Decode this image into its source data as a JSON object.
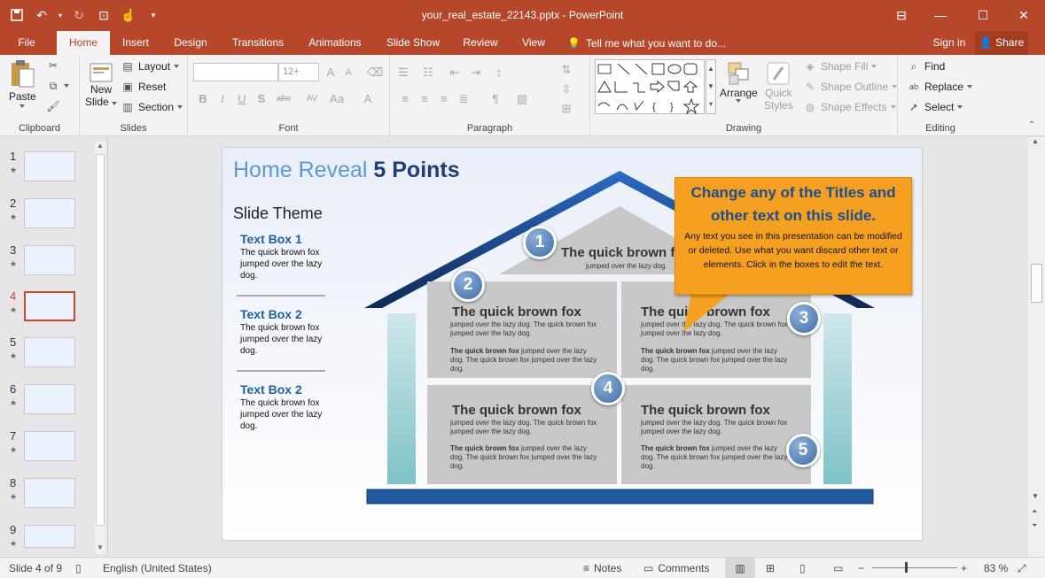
{
  "app": {
    "document_title": "your_real_estate_22143.pptx - PowerPoint"
  },
  "tabs": [
    "File",
    "Home",
    "Insert",
    "Design",
    "Transitions",
    "Animations",
    "Slide Show",
    "Review",
    "View"
  ],
  "tell_me": "Tell me what you want to do...",
  "sign_in": "Sign in",
  "share": "Share",
  "ribbon": {
    "clipboard": {
      "label": "Clipboard",
      "paste": "Paste"
    },
    "slides": {
      "label": "Slides",
      "new_slide_1": "New",
      "new_slide_2": "Slide",
      "layout": "Layout",
      "reset": "Reset",
      "section": "Section"
    },
    "font": {
      "label": "Font",
      "size_value": "12+",
      "bold": "B",
      "italic": "I",
      "underline": "U",
      "shadow": "S",
      "strike": "abc",
      "spacing": "AV",
      "case": "Aa",
      "color": "A"
    },
    "paragraph": {
      "label": "Paragraph"
    },
    "drawing": {
      "label": "Drawing",
      "arrange": "Arrange",
      "quick_styles_1": "Quick",
      "quick_styles_2": "Styles",
      "shape_fill": "Shape Fill",
      "shape_outline": "Shape Outline",
      "shape_effects": "Shape Effects"
    },
    "editing": {
      "label": "Editing",
      "find": "Find",
      "replace": "Replace",
      "select": "Select"
    }
  },
  "thumbnails": {
    "numbers": [
      "1",
      "2",
      "3",
      "4",
      "5",
      "6",
      "7",
      "8",
      "9"
    ],
    "selected": "4",
    "star": "★"
  },
  "slide": {
    "title_part1": "Home Reveal",
    "title_part2": "5 Points",
    "slide_theme": "Slide Theme",
    "text_boxes": [
      {
        "title": "Text Box 1",
        "body": "The quick brown fox jumped over the lazy dog."
      },
      {
        "title": "Text Box 2",
        "body": "The quick brown fox jumped over the lazy dog."
      },
      {
        "title": "Text Box 2",
        "body": "The quick brown fox jumped over the lazy dog."
      }
    ],
    "callout": {
      "title": "Change any of the Titles and other text on this slide.",
      "body": "Any text you see in this presentation can be modified or deleted. Use what you want discard other text or elements. Click in the boxes to edit the text."
    },
    "roof_room": {
      "title": "The quick brown fox",
      "sub": "jumped over the lazy dog."
    },
    "rooms": [
      {
        "title": "The quick brown fox",
        "p1": "jumped over the lazy dog. The quick brown fox jumped over the lazy dog.",
        "bold": "The quick brown fox",
        "p2": " jumped over the lazy dog. The quick brown fox jumped over the lazy dog."
      },
      {
        "title": "The quick brown fox",
        "p1": "jumped over the lazy dog. The quick brown fox jumped over the lazy dog.",
        "bold": "The quick brown fox",
        "p2": " jumped over the lazy dog. The quick brown fox jumped over the lazy dog."
      },
      {
        "title": "The quick brown fox",
        "p1": "jumped over the lazy dog. The quick brown fox jumped over the lazy dog.",
        "bold": "The quick brown fox",
        "p2": " jumped over the lazy dog. The quick brown fox jumped over the lazy dog."
      },
      {
        "title": "The quick brown fox",
        "p1": "jumped over the lazy dog. The quick brown fox jumped over the lazy dog.",
        "bold": "The quick brown fox",
        "p2": " jumped over the lazy dog. The quick brown fox jumped over the lazy dog."
      }
    ],
    "numbers": [
      "1",
      "2",
      "3",
      "4",
      "5"
    ]
  },
  "status": {
    "slide_info": "Slide 4 of 9",
    "language": "English (United States)",
    "notes": "Notes",
    "comments": "Comments",
    "zoom": "83 %"
  }
}
